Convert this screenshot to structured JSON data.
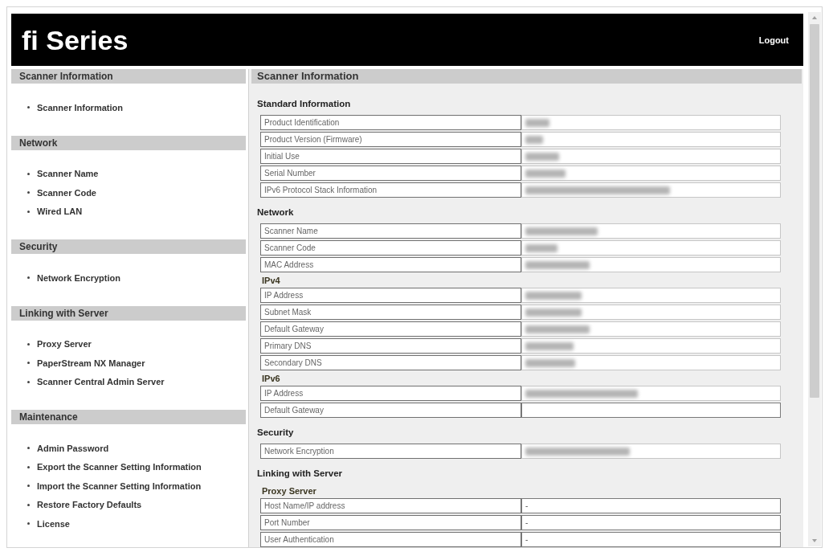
{
  "header": {
    "title": "fi Series",
    "logout": "Logout"
  },
  "sidebar": [
    {
      "heading": "Scanner Information",
      "items": [
        {
          "label": "Scanner Information"
        }
      ]
    },
    {
      "heading": "Network",
      "items": [
        {
          "label": "Scanner Name"
        },
        {
          "label": "Scanner Code"
        },
        {
          "label": "Wired LAN"
        }
      ]
    },
    {
      "heading": "Security",
      "items": [
        {
          "label": "Network Encryption"
        }
      ]
    },
    {
      "heading": "Linking with Server",
      "items": [
        {
          "label": "Proxy Server"
        },
        {
          "label": "PaperStream NX Manager"
        },
        {
          "label": "Scanner Central Admin Server"
        }
      ]
    },
    {
      "heading": "Maintenance",
      "items": [
        {
          "label": "Admin Password"
        },
        {
          "label": "Export the Scanner Setting Information"
        },
        {
          "label": "Import the Scanner Setting Information"
        },
        {
          "label": "Restore Factory Defaults"
        },
        {
          "label": "License"
        }
      ]
    }
  ],
  "content": {
    "title": "Scanner Information",
    "sections": [
      {
        "heading": "Standard Information",
        "groups": [
          {
            "rows": [
              {
                "label": "Product Identification",
                "redacted": true
              },
              {
                "label": "Product Version (Firmware)",
                "redacted": true
              },
              {
                "label": "Initial Use",
                "redacted": true
              },
              {
                "label": "Serial Number",
                "redacted": true
              },
              {
                "label": "IPv6 Protocol Stack Information",
                "redacted": true
              }
            ]
          }
        ]
      },
      {
        "heading": "Network",
        "groups": [
          {
            "rows": [
              {
                "label": "Scanner Name",
                "redacted": true
              },
              {
                "label": "Scanner Code",
                "redacted": true
              },
              {
                "label": "MAC Address",
                "redacted": true
              }
            ]
          },
          {
            "subheading": "IPv4",
            "rows": [
              {
                "label": "IP Address",
                "redacted": true
              },
              {
                "label": "Subnet Mask",
                "redacted": true
              },
              {
                "label": "Default Gateway",
                "redacted": true
              },
              {
                "label": "Primary DNS",
                "redacted": true
              },
              {
                "label": "Secondary DNS",
                "redacted": true
              }
            ]
          },
          {
            "subheading": "IPv6",
            "rows": [
              {
                "label": "IP Address",
                "redacted": true
              },
              {
                "label": "Default Gateway",
                "redacted": false
              }
            ]
          }
        ]
      },
      {
        "heading": "Security",
        "groups": [
          {
            "rows": [
              {
                "label": "Network Encryption",
                "redacted": true
              }
            ]
          }
        ]
      },
      {
        "heading": "Linking with Server",
        "groups": [
          {
            "subheading": "Proxy Server",
            "rows": [
              {
                "label": "Host Name/IP address",
                "value": "-",
                "redacted": false
              },
              {
                "label": "Port Number",
                "value": "-",
                "redacted": false
              },
              {
                "label": "User Authentication",
                "value": "-",
                "redacted": false
              }
            ]
          }
        ]
      }
    ]
  }
}
